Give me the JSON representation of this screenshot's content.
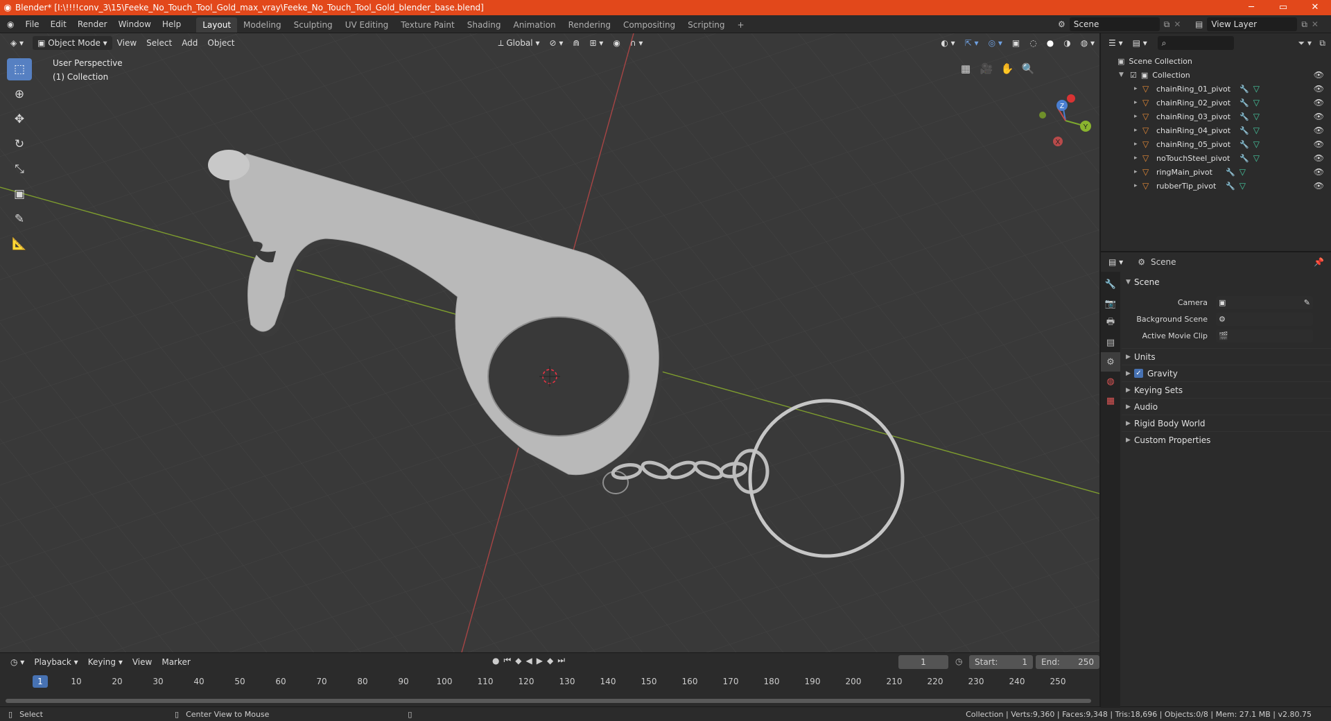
{
  "window": {
    "title": "Blender* [I:\\!!!!conv_3\\15\\Feeke_No_Touch_Tool_Gold_max_vray\\Feeke_No_Touch_Tool_Gold_blender_base.blend]",
    "min": "─",
    "max": "▭",
    "close": "✕"
  },
  "menu": [
    "File",
    "Edit",
    "Render",
    "Window",
    "Help"
  ],
  "workspaces": [
    "Layout",
    "Modeling",
    "Sculpting",
    "UV Editing",
    "Texture Paint",
    "Shading",
    "Animation",
    "Rendering",
    "Compositing",
    "Scripting"
  ],
  "workspace_add": "+",
  "scene_field": "Scene",
  "viewlayer_field": "View Layer",
  "viewport": {
    "mode": "Object Mode",
    "menus": [
      "View",
      "Select",
      "Add",
      "Object"
    ],
    "orientation": "Global",
    "perspective": "User Perspective",
    "collection": "(1) Collection",
    "gizmo": {
      "x": "X",
      "y": "Y",
      "z": "Z"
    }
  },
  "timeline": {
    "menus": [
      "Playback",
      "Keying",
      "View",
      "Marker"
    ],
    "current_frame": "1",
    "start_label": "Start:",
    "start": "1",
    "end_label": "End:",
    "end": "250",
    "ruler": [
      "10",
      "20",
      "30",
      "40",
      "50",
      "60",
      "70",
      "80",
      "90",
      "100",
      "110",
      "120",
      "130",
      "140",
      "150",
      "160",
      "170",
      "180",
      "190",
      "200",
      "210",
      "220",
      "230",
      "240",
      "250"
    ],
    "ruler_current": "1"
  },
  "status": {
    "left_action": "Select",
    "mid_action": "Center View to Mouse",
    "stats": "Collection | Verts:9,360 | Faces:9,348 | Tris:18,696 | Objects:0/8 | Mem: 27.1 MB | v2.80.75"
  },
  "outliner": {
    "root": "Scene Collection",
    "collection": "Collection",
    "items": [
      "chainRing_01_pivot",
      "chainRing_02_pivot",
      "chainRing_03_pivot",
      "chainRing_04_pivot",
      "chainRing_05_pivot",
      "noTouchSteel_pivot",
      "ringMain_pivot",
      "rubberTip_pivot"
    ]
  },
  "properties": {
    "context": "Scene",
    "panel": "Scene",
    "camera_label": "Camera",
    "bg_scene_label": "Background Scene",
    "movie_clip_label": "Active Movie Clip",
    "subpanels": [
      "Units",
      "Gravity",
      "Keying Sets",
      "Audio",
      "Rigid Body World",
      "Custom Properties"
    ]
  },
  "colors": {
    "title_bar": "#e2481b",
    "accent": "#4772b3",
    "object_icon": "#e58a37",
    "axis_x": "#b84a4a",
    "axis_y": "#8ab42e"
  }
}
